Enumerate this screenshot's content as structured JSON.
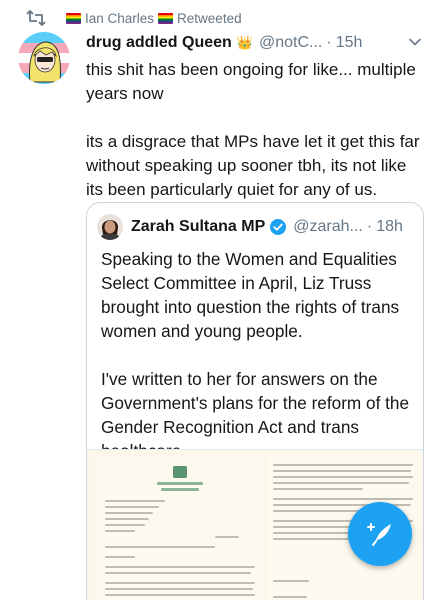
{
  "retweet": {
    "icon": "retweet-icon",
    "retweeter_name": "Ian Charles",
    "label": "Retweeted"
  },
  "tweet": {
    "author_name": "drug addled Queen",
    "author_handle": "@notC...",
    "separator": "·",
    "time": "15h",
    "text": "this shit has been ongoing for like... multiple years now\n\nits a disgrace that MPs have let it get this far without speaking up sooner tbh, its not like its been particularly quiet for any of us."
  },
  "quoted": {
    "author_name": "Zarah Sultana MP",
    "author_handle": "@zarah...",
    "separator": "·",
    "time": "18h",
    "text": "Speaking to the Women and Equalities Select Committee in April, Liz Truss brought into question the rights of trans women and young people.\n\nI've written to her for answers on the Government's plans for the reform of the Gender Recognition Act and trans healthcare."
  },
  "colors": {
    "accent": "#1da1f2",
    "muted": "#657786",
    "text": "#14171a",
    "border": "#ccd6dd"
  },
  "icons": {
    "retweet": "retweet-icon",
    "crown": "crown-icon",
    "chevron": "chevron-down-icon",
    "verified": "verified-badge-icon",
    "compose": "compose-tweet-icon"
  }
}
